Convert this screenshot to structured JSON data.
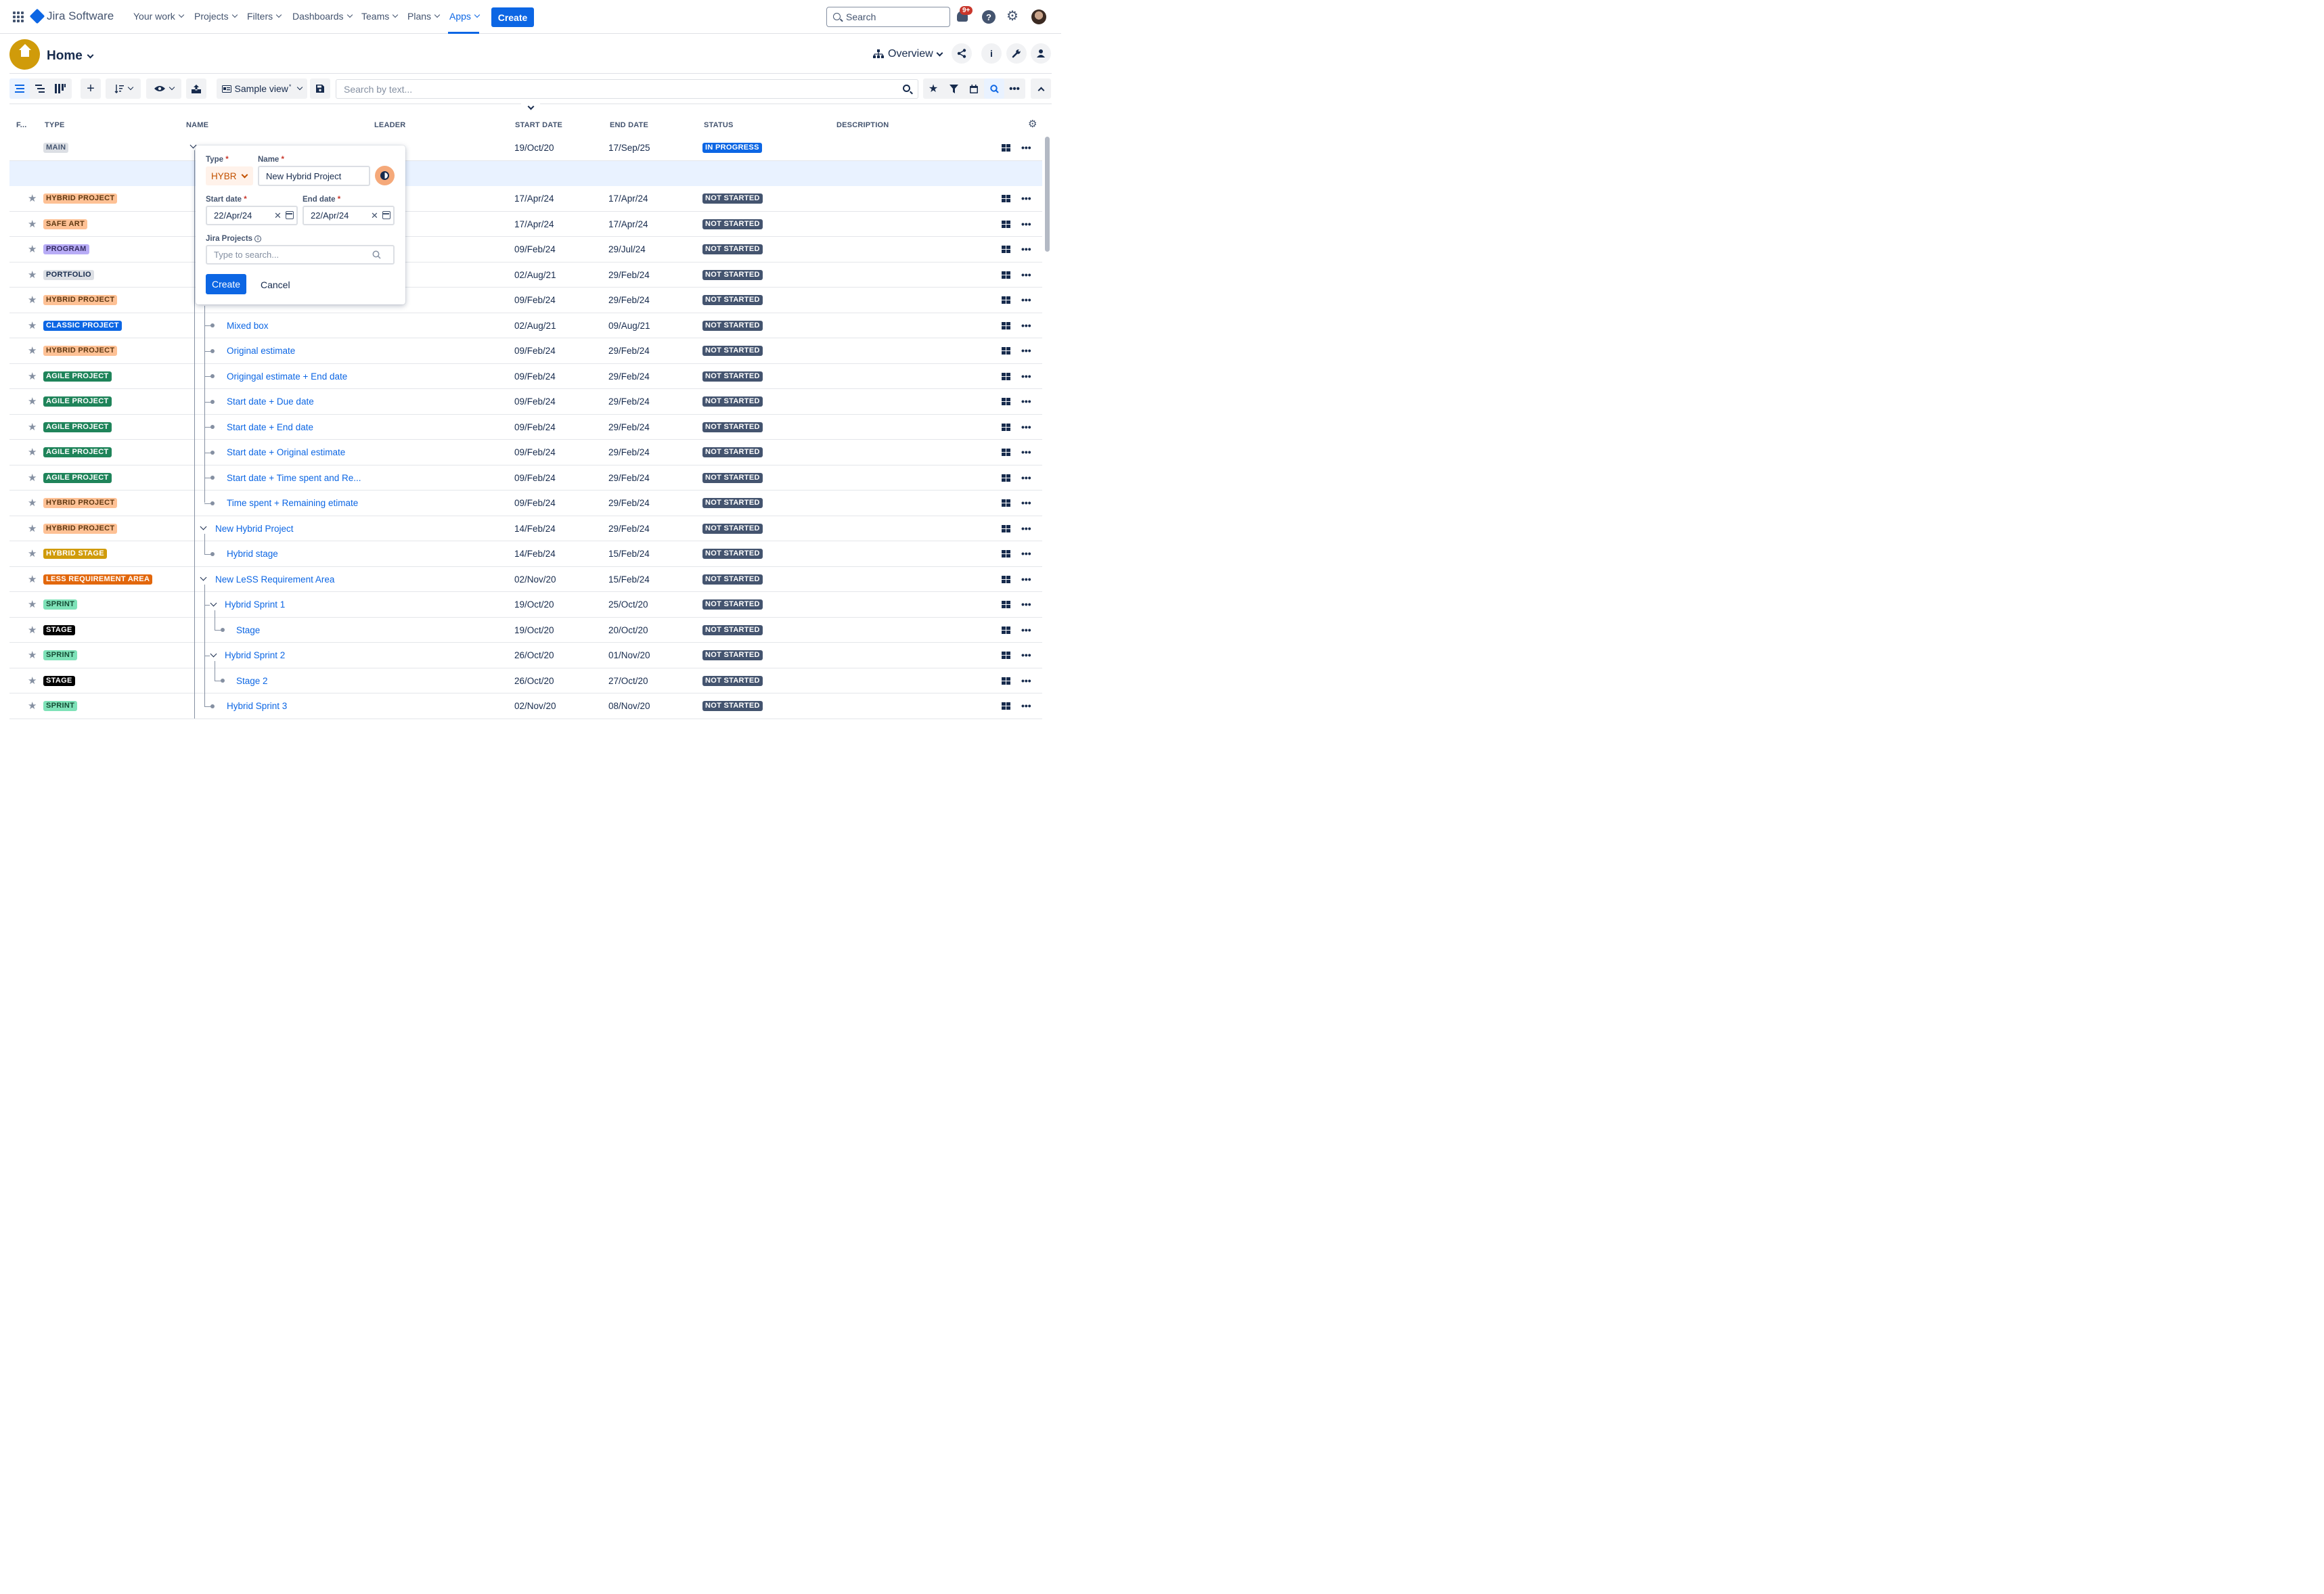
{
  "topnav": {
    "logo": "Jira Software",
    "items": [
      "Your work",
      "Projects",
      "Filters",
      "Dashboards",
      "Teams",
      "Plans",
      "Apps"
    ],
    "create_label": "Create",
    "search_placeholder": "Search",
    "notif_badge": "9+"
  },
  "header": {
    "title": "Home",
    "overview_label": "Overview"
  },
  "toolbar": {
    "view_label": "Sample view",
    "view_modified_mark": "*",
    "search_placeholder": "Search by text..."
  },
  "columns": [
    "F...",
    "TYPE",
    "NAME",
    "LEADER",
    "START DATE",
    "END DATE",
    "STATUS",
    "DESCRIPTION"
  ],
  "rows": [
    {
      "type": "MAIN",
      "name": "",
      "start": "19/Oct/20",
      "end": "17/Sep/25",
      "status": "IN PROGRESS"
    },
    {
      "type": "",
      "name": "",
      "start": "",
      "end": "",
      "status": ""
    },
    {
      "type": "HYBRID PROJECT",
      "name": "",
      "start": "17/Apr/24",
      "end": "17/Apr/24",
      "status": "NOT STARTED"
    },
    {
      "type": "SAFE ART",
      "name": "",
      "start": "17/Apr/24",
      "end": "17/Apr/24",
      "status": "NOT STARTED"
    },
    {
      "type": "PROGRAM",
      "name": "",
      "start": "09/Feb/24",
      "end": "29/Jul/24",
      "status": "NOT STARTED"
    },
    {
      "type": "PORTFOLIO",
      "name": "",
      "start": "02/Aug/21",
      "end": "29/Feb/24",
      "status": "NOT STARTED"
    },
    {
      "type": "HYBRID PROJECT",
      "name": "",
      "start": "09/Feb/24",
      "end": "29/Feb/24",
      "status": "NOT STARTED"
    },
    {
      "type": "CLASSIC PROJECT",
      "name": "Mixed box",
      "start": "02/Aug/21",
      "end": "09/Aug/21",
      "status": "NOT STARTED"
    },
    {
      "type": "HYBRID PROJECT",
      "name": "Original estimate",
      "start": "09/Feb/24",
      "end": "29/Feb/24",
      "status": "NOT STARTED"
    },
    {
      "type": "AGILE PROJECT",
      "name": "Origingal estimate + End date",
      "start": "09/Feb/24",
      "end": "29/Feb/24",
      "status": "NOT STARTED"
    },
    {
      "type": "AGILE PROJECT",
      "name": "Start date + Due date",
      "start": "09/Feb/24",
      "end": "29/Feb/24",
      "status": "NOT STARTED"
    },
    {
      "type": "AGILE PROJECT",
      "name": "Start date + End date",
      "start": "09/Feb/24",
      "end": "29/Feb/24",
      "status": "NOT STARTED"
    },
    {
      "type": "AGILE PROJECT",
      "name": "Start date + Original estimate",
      "start": "09/Feb/24",
      "end": "29/Feb/24",
      "status": "NOT STARTED"
    },
    {
      "type": "AGILE PROJECT",
      "name": "Start date + Time spent and Re...",
      "start": "09/Feb/24",
      "end": "29/Feb/24",
      "status": "NOT STARTED"
    },
    {
      "type": "HYBRID PROJECT",
      "name": "Time spent + Remaining etimate",
      "start": "09/Feb/24",
      "end": "29/Feb/24",
      "status": "NOT STARTED"
    },
    {
      "type": "HYBRID PROJECT",
      "name": "New Hybrid Project",
      "start": "14/Feb/24",
      "end": "29/Feb/24",
      "status": "NOT STARTED"
    },
    {
      "type": "HYBRID STAGE",
      "name": "Hybrid stage",
      "start": "14/Feb/24",
      "end": "15/Feb/24",
      "status": "NOT STARTED"
    },
    {
      "type": "LESS REQUIREMENT AREA",
      "name": "New LeSS Requirement Area",
      "start": "02/Nov/20",
      "end": "15/Feb/24",
      "status": "NOT STARTED"
    },
    {
      "type": "SPRINT",
      "name": "Hybrid Sprint 1",
      "start": "19/Oct/20",
      "end": "25/Oct/20",
      "status": "NOT STARTED"
    },
    {
      "type": "STAGE",
      "name": "Stage",
      "start": "19/Oct/20",
      "end": "20/Oct/20",
      "status": "NOT STARTED"
    },
    {
      "type": "SPRINT",
      "name": "Hybrid Sprint 2",
      "start": "26/Oct/20",
      "end": "01/Nov/20",
      "status": "NOT STARTED"
    },
    {
      "type": "STAGE",
      "name": "Stage 2",
      "start": "26/Oct/20",
      "end": "27/Oct/20",
      "status": "NOT STARTED"
    },
    {
      "type": "SPRINT",
      "name": "Hybrid Sprint 3",
      "start": "02/Nov/20",
      "end": "08/Nov/20",
      "status": "NOT STARTED"
    }
  ],
  "type_colors": {
    "MAIN": {
      "bg": "#dcdfe4",
      "fg": "#44546f"
    },
    "HYBRID PROJECT": {
      "bg": "#fec195",
      "fg": "#5f3811"
    },
    "SAFE ART": {
      "bg": "#fec195",
      "fg": "#5f3811"
    },
    "PROGRAM": {
      "bg": "#b8acf6",
      "fg": "#352c63"
    },
    "PORTFOLIO": {
      "bg": "#dcdfe4",
      "fg": "#172b4d"
    },
    "CLASSIC PROJECT": {
      "bg": "#0c66e4",
      "fg": "#ffffff"
    },
    "AGILE PROJECT": {
      "bg": "#1f845a",
      "fg": "#ffffff"
    },
    "HYBRID STAGE": {
      "bg": "#d09b0a",
      "fg": "#ffffff"
    },
    "LESS REQUIREMENT AREA": {
      "bg": "#e2670c",
      "fg": "#ffffff"
    },
    "SPRINT": {
      "bg": "#7ee2b8",
      "fg": "#164b35"
    },
    "STAGE": {
      "bg": "#000000",
      "fg": "#ffffff"
    }
  },
  "popup": {
    "type_label": "Type",
    "type_value": "HYBR",
    "name_label": "Name",
    "name_value": "New Hybrid Project",
    "start_label": "Start date",
    "start_value": "22/Apr/24",
    "end_label": "End date",
    "end_value": "22/Apr/24",
    "projects_label": "Jira Projects",
    "projects_placeholder": "Type to search...",
    "create_label": "Create",
    "cancel_label": "Cancel",
    "required_mark": "*"
  }
}
